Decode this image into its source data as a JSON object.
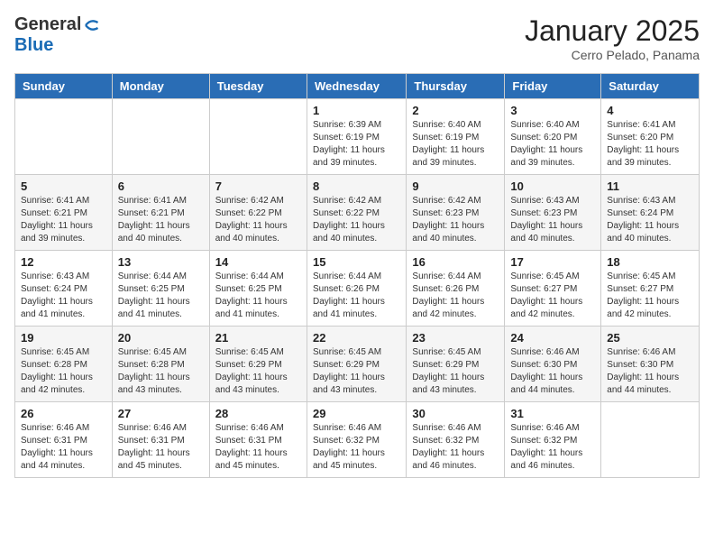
{
  "header": {
    "logo_general": "General",
    "logo_blue": "Blue",
    "month": "January 2025",
    "location": "Cerro Pelado, Panama"
  },
  "days_of_week": [
    "Sunday",
    "Monday",
    "Tuesday",
    "Wednesday",
    "Thursday",
    "Friday",
    "Saturday"
  ],
  "weeks": [
    [
      {
        "day": "",
        "info": ""
      },
      {
        "day": "",
        "info": ""
      },
      {
        "day": "",
        "info": ""
      },
      {
        "day": "1",
        "info": "Sunrise: 6:39 AM\nSunset: 6:19 PM\nDaylight: 11 hours and 39 minutes."
      },
      {
        "day": "2",
        "info": "Sunrise: 6:40 AM\nSunset: 6:19 PM\nDaylight: 11 hours and 39 minutes."
      },
      {
        "day": "3",
        "info": "Sunrise: 6:40 AM\nSunset: 6:20 PM\nDaylight: 11 hours and 39 minutes."
      },
      {
        "day": "4",
        "info": "Sunrise: 6:41 AM\nSunset: 6:20 PM\nDaylight: 11 hours and 39 minutes."
      }
    ],
    [
      {
        "day": "5",
        "info": "Sunrise: 6:41 AM\nSunset: 6:21 PM\nDaylight: 11 hours and 39 minutes."
      },
      {
        "day": "6",
        "info": "Sunrise: 6:41 AM\nSunset: 6:21 PM\nDaylight: 11 hours and 40 minutes."
      },
      {
        "day": "7",
        "info": "Sunrise: 6:42 AM\nSunset: 6:22 PM\nDaylight: 11 hours and 40 minutes."
      },
      {
        "day": "8",
        "info": "Sunrise: 6:42 AM\nSunset: 6:22 PM\nDaylight: 11 hours and 40 minutes."
      },
      {
        "day": "9",
        "info": "Sunrise: 6:42 AM\nSunset: 6:23 PM\nDaylight: 11 hours and 40 minutes."
      },
      {
        "day": "10",
        "info": "Sunrise: 6:43 AM\nSunset: 6:23 PM\nDaylight: 11 hours and 40 minutes."
      },
      {
        "day": "11",
        "info": "Sunrise: 6:43 AM\nSunset: 6:24 PM\nDaylight: 11 hours and 40 minutes."
      }
    ],
    [
      {
        "day": "12",
        "info": "Sunrise: 6:43 AM\nSunset: 6:24 PM\nDaylight: 11 hours and 41 minutes."
      },
      {
        "day": "13",
        "info": "Sunrise: 6:44 AM\nSunset: 6:25 PM\nDaylight: 11 hours and 41 minutes."
      },
      {
        "day": "14",
        "info": "Sunrise: 6:44 AM\nSunset: 6:25 PM\nDaylight: 11 hours and 41 minutes."
      },
      {
        "day": "15",
        "info": "Sunrise: 6:44 AM\nSunset: 6:26 PM\nDaylight: 11 hours and 41 minutes."
      },
      {
        "day": "16",
        "info": "Sunrise: 6:44 AM\nSunset: 6:26 PM\nDaylight: 11 hours and 42 minutes."
      },
      {
        "day": "17",
        "info": "Sunrise: 6:45 AM\nSunset: 6:27 PM\nDaylight: 11 hours and 42 minutes."
      },
      {
        "day": "18",
        "info": "Sunrise: 6:45 AM\nSunset: 6:27 PM\nDaylight: 11 hours and 42 minutes."
      }
    ],
    [
      {
        "day": "19",
        "info": "Sunrise: 6:45 AM\nSunset: 6:28 PM\nDaylight: 11 hours and 42 minutes."
      },
      {
        "day": "20",
        "info": "Sunrise: 6:45 AM\nSunset: 6:28 PM\nDaylight: 11 hours and 43 minutes."
      },
      {
        "day": "21",
        "info": "Sunrise: 6:45 AM\nSunset: 6:29 PM\nDaylight: 11 hours and 43 minutes."
      },
      {
        "day": "22",
        "info": "Sunrise: 6:45 AM\nSunset: 6:29 PM\nDaylight: 11 hours and 43 minutes."
      },
      {
        "day": "23",
        "info": "Sunrise: 6:45 AM\nSunset: 6:29 PM\nDaylight: 11 hours and 43 minutes."
      },
      {
        "day": "24",
        "info": "Sunrise: 6:46 AM\nSunset: 6:30 PM\nDaylight: 11 hours and 44 minutes."
      },
      {
        "day": "25",
        "info": "Sunrise: 6:46 AM\nSunset: 6:30 PM\nDaylight: 11 hours and 44 minutes."
      }
    ],
    [
      {
        "day": "26",
        "info": "Sunrise: 6:46 AM\nSunset: 6:31 PM\nDaylight: 11 hours and 44 minutes."
      },
      {
        "day": "27",
        "info": "Sunrise: 6:46 AM\nSunset: 6:31 PM\nDaylight: 11 hours and 45 minutes."
      },
      {
        "day": "28",
        "info": "Sunrise: 6:46 AM\nSunset: 6:31 PM\nDaylight: 11 hours and 45 minutes."
      },
      {
        "day": "29",
        "info": "Sunrise: 6:46 AM\nSunset: 6:32 PM\nDaylight: 11 hours and 45 minutes."
      },
      {
        "day": "30",
        "info": "Sunrise: 6:46 AM\nSunset: 6:32 PM\nDaylight: 11 hours and 46 minutes."
      },
      {
        "day": "31",
        "info": "Sunrise: 6:46 AM\nSunset: 6:32 PM\nDaylight: 11 hours and 46 minutes."
      },
      {
        "day": "",
        "info": ""
      }
    ]
  ]
}
